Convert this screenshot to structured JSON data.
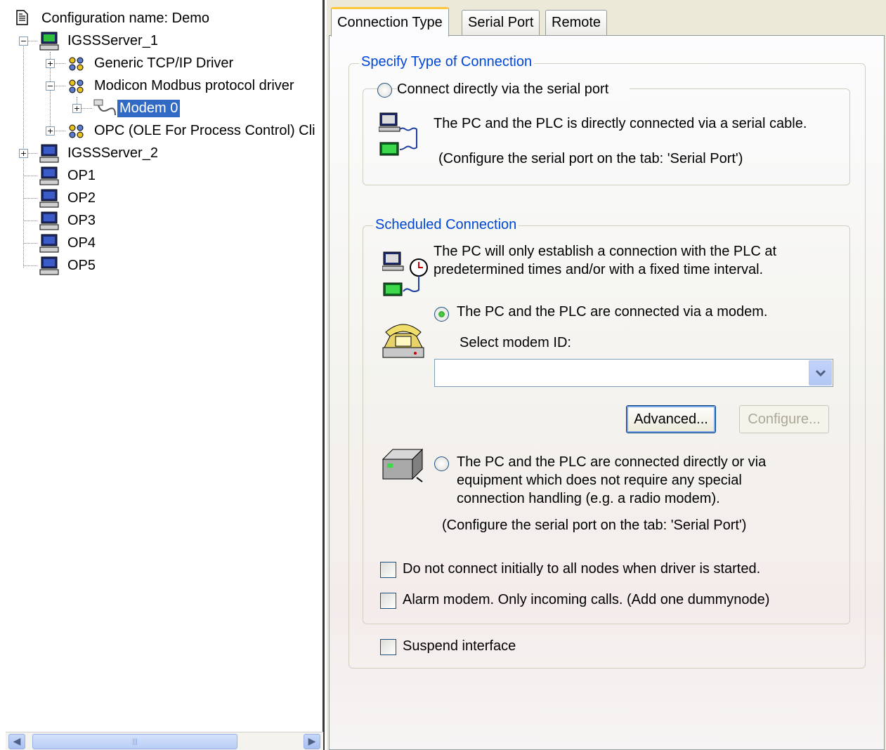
{
  "tree": {
    "root_label": "Configuration name: Demo",
    "server1": "IGSSServer_1",
    "driver_generic": "Generic TCP/IP Driver",
    "driver_modbus": "Modicon Modbus protocol driver",
    "modem": "Modem 0",
    "driver_opc": "OPC (OLE For Process Control) Cli",
    "server2": "IGSSServer_2",
    "op1": "OP1",
    "op2": "OP2",
    "op3": "OP3",
    "op4": "OP4",
    "op5": "OP5"
  },
  "tabs": {
    "connection_type": "Connection Type",
    "serial_port": "Serial Port",
    "remote": "Remote"
  },
  "specify": {
    "title": "Specify Type of Connection",
    "direct_radio": "Connect directly via the serial port",
    "direct_desc": "The PC and the PLC is directly connected via a serial cable.",
    "direct_hint": "(Configure the serial port on the tab: 'Serial Port')"
  },
  "scheduled": {
    "title": "Scheduled Connection",
    "desc_line1": "The PC will only establish a connection with the PLC at",
    "desc_line2": "predetermined times and/or with a fixed time interval.",
    "modem_radio": "The PC and the PLC are connected via a modem.",
    "select_modem_label": "Select modem ID:",
    "modem_value": "",
    "advanced_button": "Advanced...",
    "configure_button": "Configure...",
    "equip_line1": "The PC and the PLC are connected directly or via",
    "equip_line2": "equipment which does not require any special",
    "equip_line3": "connection handling (e.g. a radio modem).",
    "equip_hint": "(Configure the serial port on the tab: 'Serial Port')",
    "no_connect_checkbox": "Do not connect initially to all nodes when driver is started.",
    "alarm_modem_checkbox": "Alarm modem. Only incoming calls. (Add one dummynode)"
  },
  "suspend_checkbox": "Suspend interface",
  "state": {
    "selected_radio": "modem",
    "no_connect_checked": false,
    "alarm_modem_checked": false,
    "suspend_checked": false
  },
  "colors": {
    "selection": "#316ac5",
    "group_title": "#0046d5",
    "active_tab_highlight": "#ffc83c"
  }
}
